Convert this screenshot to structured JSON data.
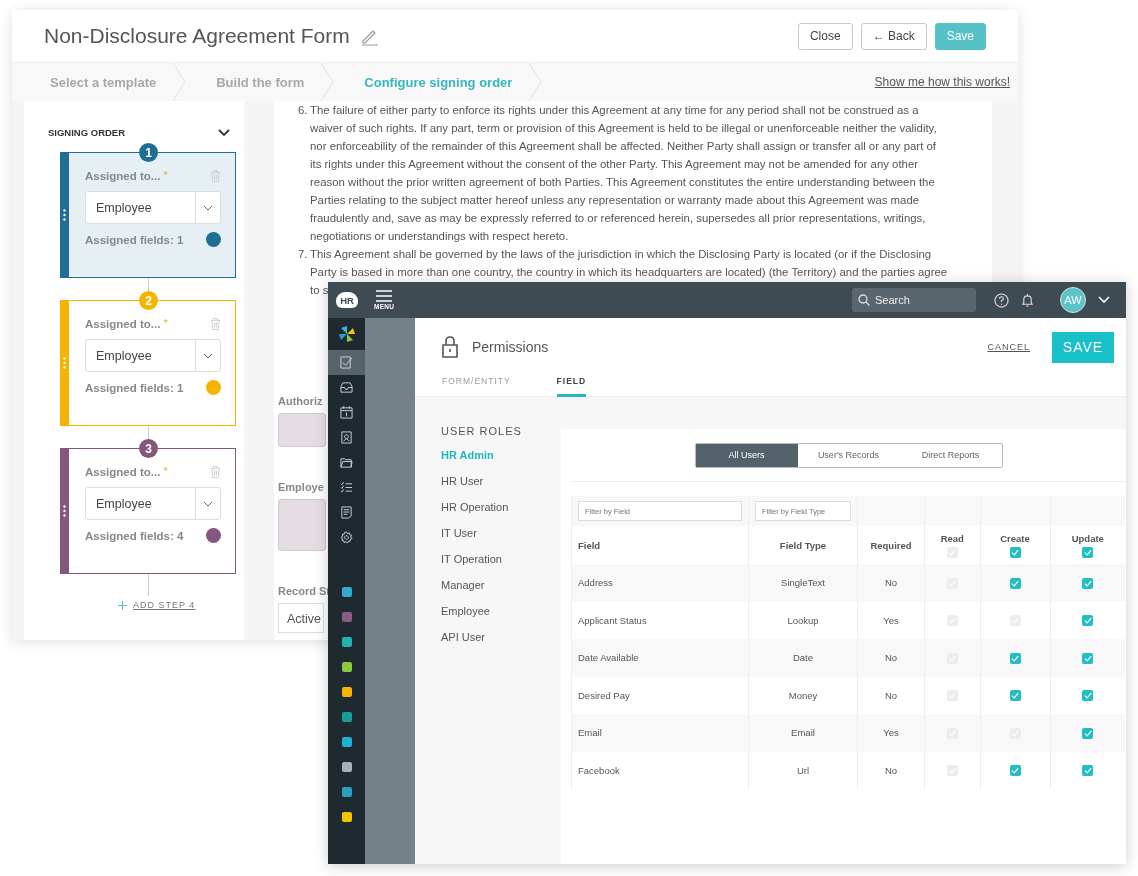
{
  "form_window": {
    "title": "Non-Disclosure Agreement Form",
    "buttons": [
      {
        "label": "Close",
        "kind": "plain"
      },
      {
        "label": "← Back",
        "kind": "plain"
      },
      {
        "label": "Save",
        "kind": "primary"
      }
    ],
    "steps": [
      {
        "label": "Select a template",
        "selected": false
      },
      {
        "label": "Build the form",
        "selected": false
      },
      {
        "label": "Configure signing order",
        "selected": true
      }
    ],
    "help_link": "Show me how this works!",
    "signing_order": {
      "title": "SIGNING ORDER",
      "cards": [
        {
          "number": "1",
          "color": "#1f6f94",
          "selected": true,
          "label": "Assigned to...",
          "required": "*",
          "value": "Employee",
          "fields": "Assigned fields: 1"
        },
        {
          "number": "2",
          "color": "#f5b400",
          "selected": false,
          "label": "Assigned to...",
          "required": "*",
          "value": "Employee",
          "fields": "Assigned fields: 1"
        },
        {
          "number": "3",
          "color": "#86577c",
          "selected": false,
          "label": "Assigned to...",
          "required": "*",
          "value": "Employee",
          "fields": "Assigned fields: 4"
        }
      ],
      "add_step": "ADD STEP 4"
    },
    "document": {
      "paragraphs": [
        {
          "number": "6.",
          "lines": [
            "The failure of either party to enforce its rights under this Agreement at any time for any period shall not be construed as a",
            "waiver of such rights. If any part, term or provision of this Agreement is held to be illegal or unenforceable neither the validity,",
            "nor enforceability of the remainder of this Agreement shall be affected. Neither Party shall assign or transfer all or any part of",
            "its rights under this Agreement without the consent of the other Party. This Agreement may not be amended for any other",
            "reason without the prior written agreement of both Parties. This Agreement constitutes the entire understanding between the",
            "Parties relating to the subject matter hereof unless any representation or warranty made about this Agreement was made",
            "fraudulently and, save as may be expressly referred to or referenced herein, supersedes all prior representations, writings,",
            "negotiations or understandings with respect hereto."
          ]
        },
        {
          "number": "7.",
          "lines": [
            "This Agreement shall be governed by the laws of the jurisdiction in which the Disclosing Party is located (or if the Disclosing",
            "Party is based in more than one country, the country in which its headquarters are located) (the Territory) and the parties agree",
            "to s"
          ]
        }
      ],
      "fields": [
        {
          "label": "Authoriz",
          "kind": "box"
        },
        {
          "label": "Employe",
          "kind": "tall"
        },
        {
          "label": "Record St",
          "kind": "select",
          "value": "Active"
        }
      ]
    }
  },
  "hr_window": {
    "logo": "HR",
    "menu": "MENU",
    "search": {
      "placeholder": "Search"
    },
    "avatar": "AW",
    "nav_icons": [
      {
        "kind": "tasks",
        "selected": true
      },
      {
        "kind": "inbox",
        "selected": false
      },
      {
        "kind": "calendar",
        "selected": false
      },
      {
        "kind": "contact",
        "selected": false
      },
      {
        "kind": "folder",
        "selected": false
      },
      {
        "kind": "checklist",
        "selected": false
      },
      {
        "kind": "document",
        "selected": false
      },
      {
        "kind": "settings",
        "selected": false
      }
    ],
    "apps": [
      {
        "color": "#3aa9cf"
      },
      {
        "color": "#8a5d86"
      },
      {
        "color": "#22b3b0"
      },
      {
        "color": "#8dc63f"
      },
      {
        "color": "#f5b400"
      },
      {
        "color": "#1a9c9a"
      },
      {
        "color": "#1fb0d3"
      },
      {
        "color": "#a7b0b5"
      },
      {
        "color": "#2a9fc4"
      },
      {
        "color": "#f2c500"
      }
    ],
    "title": "Permissions",
    "cancel": "CANCEL",
    "save": "SAVE",
    "tabs": [
      {
        "label": "FORM/ENTITY",
        "selected": false
      },
      {
        "label": "FIELD",
        "selected": true
      }
    ],
    "roles_title": "USER ROLES",
    "roles": [
      {
        "label": "HR Admin",
        "selected": true
      },
      {
        "label": "HR User",
        "selected": false
      },
      {
        "label": "HR Operation",
        "selected": false
      },
      {
        "label": "IT User",
        "selected": false
      },
      {
        "label": "IT Operation",
        "selected": false
      },
      {
        "label": "Manager",
        "selected": false
      },
      {
        "label": "Employee",
        "selected": false
      },
      {
        "label": "API User",
        "selected": false
      }
    ],
    "scope": [
      {
        "label": "All Users",
        "selected": true
      },
      {
        "label": "User's Records",
        "selected": false
      },
      {
        "label": "Direct Reports",
        "selected": false
      }
    ],
    "filters": [
      {
        "placeholder": "Filter by Field"
      },
      {
        "placeholder": "Filter by Field Type"
      }
    ],
    "table": {
      "columns": [
        {
          "label": "Field"
        },
        {
          "label": "Field Type"
        },
        {
          "label": "Required"
        },
        {
          "label": "Read",
          "checked": false
        },
        {
          "label": "Create",
          "checked": true
        },
        {
          "label": "Update",
          "checked": true
        }
      ],
      "rows": [
        {
          "field": "Address",
          "type": "SingleText",
          "required": "No",
          "read": false,
          "create": true,
          "update": true
        },
        {
          "field": "Applicant Status",
          "type": "Lookup",
          "required": "Yes",
          "read": false,
          "create": false,
          "update": true
        },
        {
          "field": "Date Available",
          "type": "Date",
          "required": "No",
          "read": false,
          "create": true,
          "update": true
        },
        {
          "field": "Desired Pay",
          "type": "Money",
          "required": "No",
          "read": false,
          "create": true,
          "update": true
        },
        {
          "field": "Email",
          "type": "Email",
          "required": "Yes",
          "read": false,
          "create": false,
          "update": true
        },
        {
          "field": "Facebook",
          "type": "Url",
          "required": "No",
          "read": false,
          "create": true,
          "update": true
        }
      ]
    }
  }
}
